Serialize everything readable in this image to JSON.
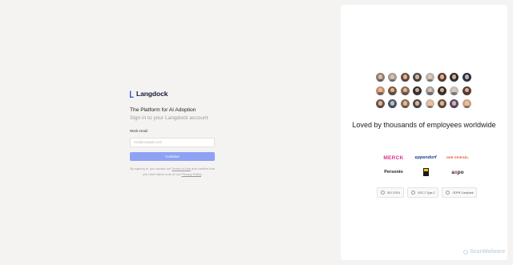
{
  "login": {
    "brand": "Langdock",
    "title": "The Platform for AI Adoption",
    "subtitle": "Sign in to your Langdock account",
    "email_label": "Work email",
    "email_placeholder": "me@example.com",
    "email_value": "",
    "continue_label": "Continue",
    "terms_prefix": "By signing in, you accept our",
    "terms_link": "Terms of Use",
    "terms_mid": "and confirm that you have taken note of our",
    "privacy_link": "Privacy Policy",
    "terms_suffix": ".",
    "accent_color": "#8ea2f5"
  },
  "showcase": {
    "avatars": [
      "#8a7e76",
      "#a19b97",
      "#6b4a3b",
      "#4a4a4a",
      "#b7b3b0",
      "#5e3b2a",
      "#2c2c2c",
      "#25304a",
      "#c08f6b",
      "#7a5a3f",
      "#8c6a53",
      "#303030",
      "#9aa0a6",
      "#3a2a22",
      "#bdbdbd",
      "#5d3d2e",
      "#6e5548",
      "#3e5a7a",
      "#8b6b50",
      "#4b4b4b",
      "#d3b6a0",
      "#6a4c3a",
      "#5a4a6a",
      "#c9a27e"
    ],
    "headline": "Loved by thousands of employees worldwide",
    "customer_logos": {
      "merck": "MERCK",
      "eppendorf": "eppendorf",
      "spiegel": "DER SPIEGEL",
      "personio": "Personio",
      "axpo_a": "a",
      "axpo_x": "x",
      "axpo_po": "po"
    },
    "certifications": [
      {
        "label": "ISO 27001"
      },
      {
        "label": "SOC 2 Type 2"
      },
      {
        "label": "GDPR Compliant"
      }
    ]
  },
  "watermark": "ScanMalware"
}
